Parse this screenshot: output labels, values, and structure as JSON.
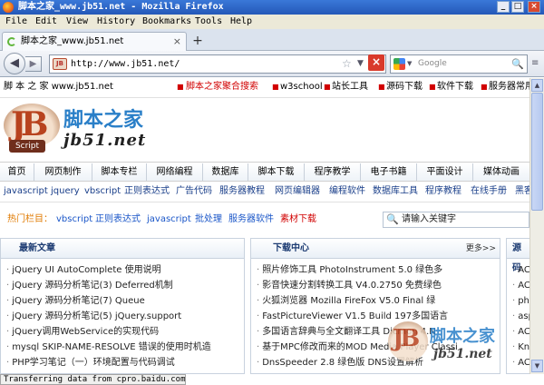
{
  "window": {
    "title": "脚本之家_www.jb51.net - Mozilla Firefox",
    "min": "_",
    "max": "□",
    "close": "×"
  },
  "menu": [
    "File",
    "Edit",
    "View",
    "History",
    "Bookmarks",
    "Tools",
    "Help"
  ],
  "tab": {
    "label": "脚本之家_www.jb51.net",
    "close": "×",
    "new_tab": "+"
  },
  "nav": {
    "back": "◀",
    "forward": "▶",
    "site_icon": "JB",
    "url": "http://www.jb51.net/",
    "star": "☆",
    "dropdown": "▼",
    "stop": "×",
    "search_placeholder": "Google",
    "search_icon": "🔍",
    "menu_glyph": "≡"
  },
  "page": {
    "top": {
      "site": "脚 本 之 家 www.jb51.net",
      "links": [
        "脚本之家聚合搜索",
        "w3school",
        "站长工具",
        "源码下载",
        "软件下载",
        "服务器常用"
      ]
    },
    "logo": {
      "mark": "JB",
      "script": "Script",
      "cn": "脚本之家",
      "en": "jb51.net"
    },
    "main_nav": [
      "首页",
      "网页制作",
      "脚本专栏",
      "网络编程",
      "数据库",
      "脚本下载",
      "程序教学",
      "电子书籍",
      "平面设计",
      "媒体动画"
    ],
    "sub_nav": [
      "javascript",
      "jquery",
      "vbscript",
      "正则表达式",
      "广告代码",
      "服务器教程",
      "网页编辑器",
      "编程软件",
      "数据库工具",
      "程序教程",
      "在线手册",
      "黑客"
    ],
    "hot": {
      "label": "热门栏目：",
      "links": [
        "vbscript",
        "正则表达式",
        "javascript",
        "批处理",
        "服务器软件",
        "素材下载"
      ],
      "search_placeholder": "请输入关键字"
    },
    "panels": [
      {
        "title": "最新文章",
        "items": [
          "jQuery UI AutoComplete 使用说明",
          "jQuery 源码分析笔记(3) Deferred机制",
          "jQuery 源码分析笔记(7) Queue",
          "jQuery 源码分析笔记(5) jQuery.support",
          "jQuery调用WebService的实现代码",
          "mysql SKIP-NAME-RESOLVE 错误的使用时机造",
          "PHP学习笔记（一）环境配置与代码调试"
        ]
      },
      {
        "title": "下载中心",
        "more": "更多>>",
        "items": [
          "照片修饰工具 PhotoInstrument 5.0 绿色多",
          "影音快速分割转换工具 V4.0.2750 免费绿色",
          "火狐浏览器 Mozilla FireFox V5.0 Final 绿",
          "FastPictureViewer V1.5 Build 197多国语言",
          "多国语言辞典与全文翻译工具 Dicmon 4.N",
          "基于MPC修改而来的MOD Media Player Classi",
          "DnsSpeeder 2.8 绿色版 DNS设置解析"
        ]
      },
      {
        "title": "源码",
        "items": [
          "ACT",
          "ACT",
          "php",
          "asp",
          "ACT",
          "KnF",
          "ACT"
        ]
      }
    ],
    "watermark": {
      "mark": "JB",
      "cn": "脚本之家",
      "en": "jb51.net"
    }
  },
  "scrollbar": {
    "up": "▲",
    "down": "▼"
  },
  "status": "Transferring data from cpro.baidu.com..."
}
